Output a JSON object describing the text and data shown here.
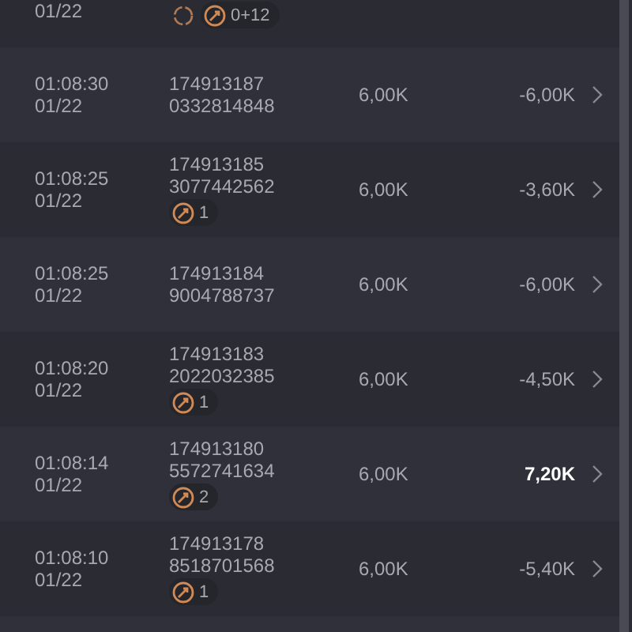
{
  "rows": [
    {
      "time": "",
      "date": "01/22",
      "ids": [],
      "badges": [
        {
          "kind": "spinner"
        },
        {
          "kind": "compass",
          "count": "0+12"
        }
      ],
      "stake": "",
      "amount": ""
    },
    {
      "time": "01:08:30",
      "date": "01/22",
      "ids": [
        "174913187",
        "0332814848"
      ],
      "badges": [],
      "stake": "6,00K",
      "amount": "-6,00K",
      "won": false
    },
    {
      "time": "01:08:25",
      "date": "01/22",
      "ids": [
        "174913185",
        "3077442562"
      ],
      "badges": [
        {
          "kind": "compass",
          "count": "1"
        }
      ],
      "stake": "6,00K",
      "amount": "-3,60K",
      "won": false
    },
    {
      "time": "01:08:25",
      "date": "01/22",
      "ids": [
        "174913184",
        "9004788737"
      ],
      "badges": [],
      "stake": "6,00K",
      "amount": "-6,00K",
      "won": false
    },
    {
      "time": "01:08:20",
      "date": "01/22",
      "ids": [
        "174913183",
        "2022032385"
      ],
      "badges": [
        {
          "kind": "compass",
          "count": "1"
        }
      ],
      "stake": "6,00K",
      "amount": "-4,50K",
      "won": false
    },
    {
      "time": "01:08:14",
      "date": "01/22",
      "ids": [
        "174913180",
        "5572741634"
      ],
      "badges": [
        {
          "kind": "compass",
          "count": "2"
        }
      ],
      "stake": "6,00K",
      "amount": "7,20K",
      "won": true
    },
    {
      "time": "01:08:10",
      "date": "01/22",
      "ids": [
        "174913178",
        "8518701568"
      ],
      "badges": [
        {
          "kind": "compass",
          "count": "1"
        }
      ],
      "stake": "6,00K",
      "amount": "-5,40K",
      "won": false
    }
  ]
}
